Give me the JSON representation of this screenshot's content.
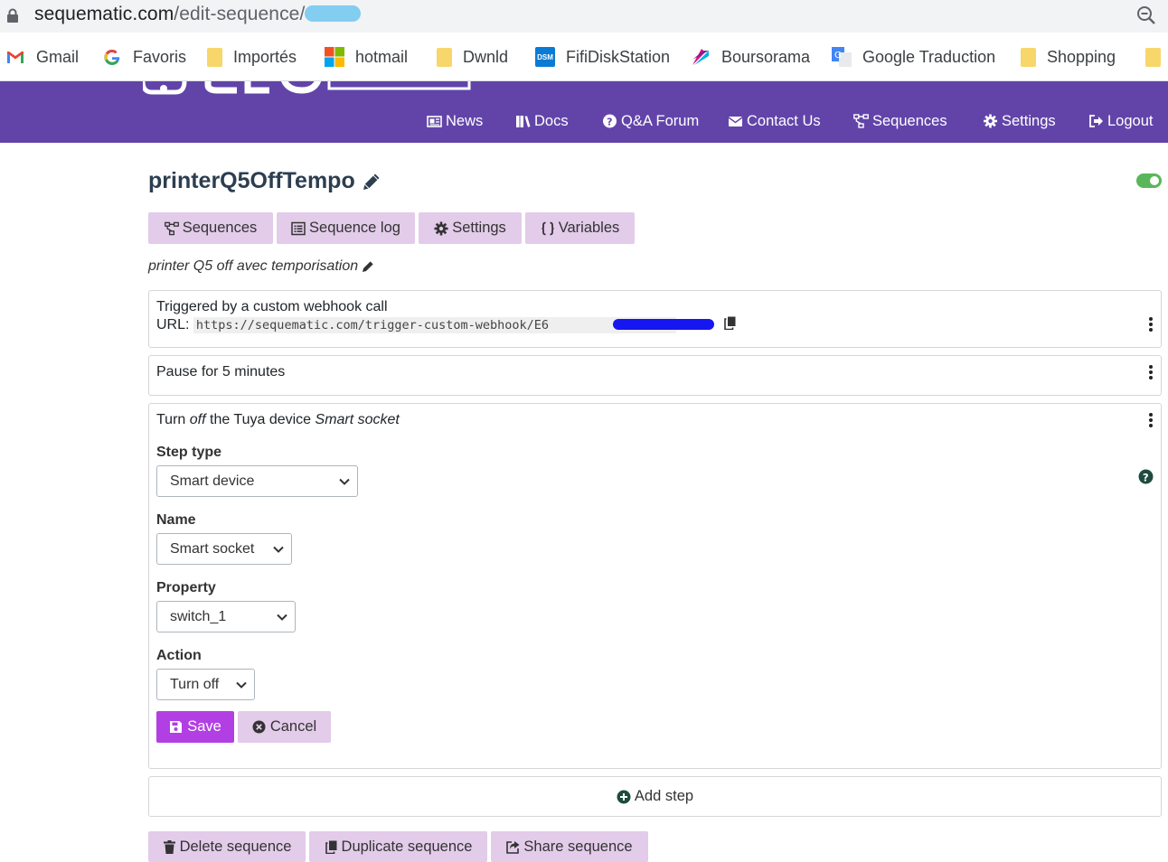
{
  "browser": {
    "url_host": "sequematic.com",
    "url_path": "/edit-sequence/",
    "bookmarks": [
      {
        "label": "Gmail",
        "icon": "gmail-icon"
      },
      {
        "label": "Favoris",
        "icon": "google-icon"
      },
      {
        "label": "Importés",
        "icon": "folder-icon"
      },
      {
        "label": "hotmail",
        "icon": "microsoft-icon"
      },
      {
        "label": "Dwnld",
        "icon": "folder-icon"
      },
      {
        "label": "FifiDiskStation",
        "icon": "dsm-icon"
      },
      {
        "label": "Boursorama",
        "icon": "boursorama-icon"
      },
      {
        "label": "Google Traduction",
        "icon": "translate-icon"
      },
      {
        "label": "Shopping",
        "icon": "folder-icon"
      }
    ],
    "dsm_badge": "DSM"
  },
  "nav": {
    "news": "News",
    "docs": "Docs",
    "forum": "Q&A Forum",
    "contact": "Contact Us",
    "sequences": "Sequences",
    "settings": "Settings",
    "logout": "Logout"
  },
  "sequence": {
    "title": "printerQ5OffTempo",
    "enabled": true,
    "description": "printer Q5 off avec temporisation"
  },
  "tabs": {
    "sequences": "Sequences",
    "log": "Sequence log",
    "settings": "Settings",
    "variables": "Variables"
  },
  "steps": {
    "trigger": {
      "line1": "Triggered by a custom webhook call",
      "url_label": "URL:",
      "url_value": "https://sequematic.com/trigger-custom-webhook/E6"
    },
    "pause": {
      "text": "Pause for 5 minutes"
    },
    "action": {
      "prefix": "Turn ",
      "state": "off",
      "middle": " the Tuya device ",
      "device": "Smart socket",
      "step_type_label": "Step type",
      "step_type_value": "Smart device",
      "name_label": "Name",
      "name_value": "Smart socket",
      "property_label": "Property",
      "property_value": "switch_1",
      "action_label": "Action",
      "action_value": "Turn off",
      "save": "Save",
      "cancel": "Cancel"
    }
  },
  "add_step": "Add step",
  "footer": {
    "delete": "Delete sequence",
    "duplicate": "Duplicate sequence",
    "share": "Share sequence"
  },
  "colors": {
    "navbar": "#6244a9",
    "accent": "#b23fe3",
    "button_light": "#e3cbea",
    "toggle_on": "#5ab65a"
  }
}
